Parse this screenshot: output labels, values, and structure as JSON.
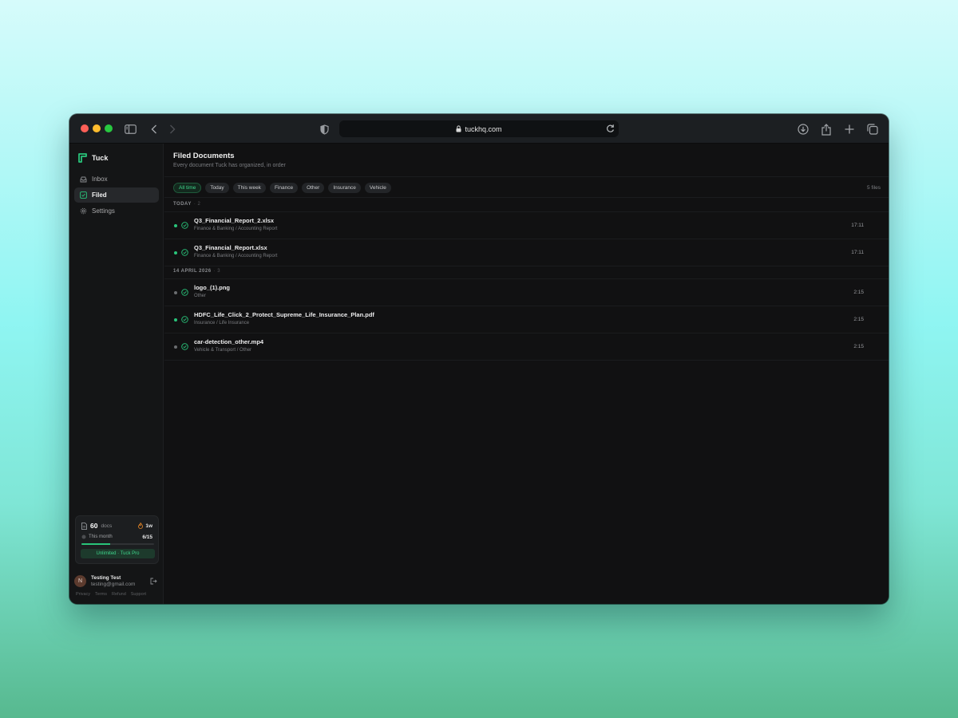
{
  "browser": {
    "url": "tuckhq.com"
  },
  "app": {
    "name": "Tuck",
    "accent": "#29c47a"
  },
  "sidebar": {
    "items": [
      {
        "label": "Inbox",
        "icon": "inbox-icon"
      },
      {
        "label": "Filed",
        "icon": "filed-check-icon",
        "active": true
      },
      {
        "label": "Settings",
        "icon": "gear-icon"
      }
    ],
    "usage": {
      "docs_count": "60",
      "docs_label": "docs",
      "streak": "1w",
      "period_label": "This month",
      "quota": "6/15",
      "progress": 0.4,
      "plan": "Unlimited · Tuck Pro"
    },
    "user": {
      "initial": "N",
      "name": "Testing Test",
      "email": "testing@gmail.com"
    },
    "footer_links": [
      "Privacy",
      "Terms",
      "Refund",
      "Support"
    ]
  },
  "main": {
    "title": "Filed Documents",
    "subtitle": "Every document Tuck has organized, in order",
    "filters": [
      "All time",
      "Today",
      "This week",
      "Finance",
      "Other",
      "Insurance",
      "Vehicle"
    ],
    "active_filter": "All time",
    "file_count": "5 files",
    "groups": [
      {
        "label": "TODAY",
        "count": "2",
        "docs": [
          {
            "name": "Q3_Financial_Report_2.xlsx",
            "category": "Finance & Banking / Accounting Report",
            "time": "17:11",
            "dot_color": "#29c47a"
          },
          {
            "name": "Q3_Financial_Report.xlsx",
            "category": "Finance & Banking / Accounting Report",
            "time": "17:11",
            "dot_color": "#29c47a"
          }
        ]
      },
      {
        "label": "14 APRIL 2026",
        "count": "3",
        "docs": [
          {
            "name": "logo_(1).png",
            "category": "Other",
            "time": "2:15",
            "dot_color": "#6b6d70"
          },
          {
            "name": "HDFC_Life_Click_2_Protect_Supreme_Life_Insurance_Plan.pdf",
            "category": "Insurance / Life Insurance",
            "time": "2:15",
            "dot_color": "#29c47a"
          },
          {
            "name": "car-detection_other.mp4",
            "category": "Vehicle & Transport / Other",
            "time": "2:15",
            "dot_color": "#6b6d70"
          }
        ]
      }
    ]
  }
}
